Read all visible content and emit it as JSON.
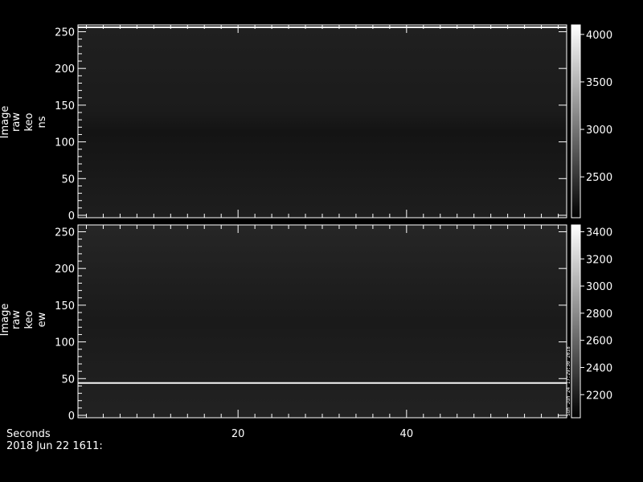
{
  "chart_data": [
    {
      "type": "heatmap",
      "ylabel": [
        "Image",
        "raw",
        "keo",
        "ns"
      ],
      "ylim": [
        0,
        256
      ],
      "yticks": [
        0,
        50,
        100,
        150,
        200,
        250
      ],
      "colorbar": {
        "ticks": [
          2500,
          3000,
          3500,
          4000
        ],
        "range": [
          2070,
          4100
        ]
      },
      "bright_rows": [
        {
          "y": 256,
          "value": 4000
        }
      ],
      "background_value": 2200
    },
    {
      "type": "heatmap",
      "ylabel": [
        "Image",
        "raw",
        "keo",
        "ew"
      ],
      "ylim": [
        0,
        256
      ],
      "yticks": [
        0,
        50,
        100,
        150,
        200,
        250
      ],
      "colorbar": {
        "ticks": [
          2200,
          2400,
          2600,
          2800,
          3000,
          3200,
          3400
        ],
        "range": [
          2030,
          3450
        ]
      },
      "bright_rows": [
        {
          "y": 44,
          "value": 3400
        }
      ],
      "background_value": 2150
    }
  ],
  "xaxis": {
    "label": "Seconds",
    "ticks": [
      20,
      40
    ],
    "xlim": [
      1,
      59
    ]
  },
  "date_label": "2018 Jun 22 1611:",
  "vertical_note": "Sun Jun 24 17:29:30 2018"
}
